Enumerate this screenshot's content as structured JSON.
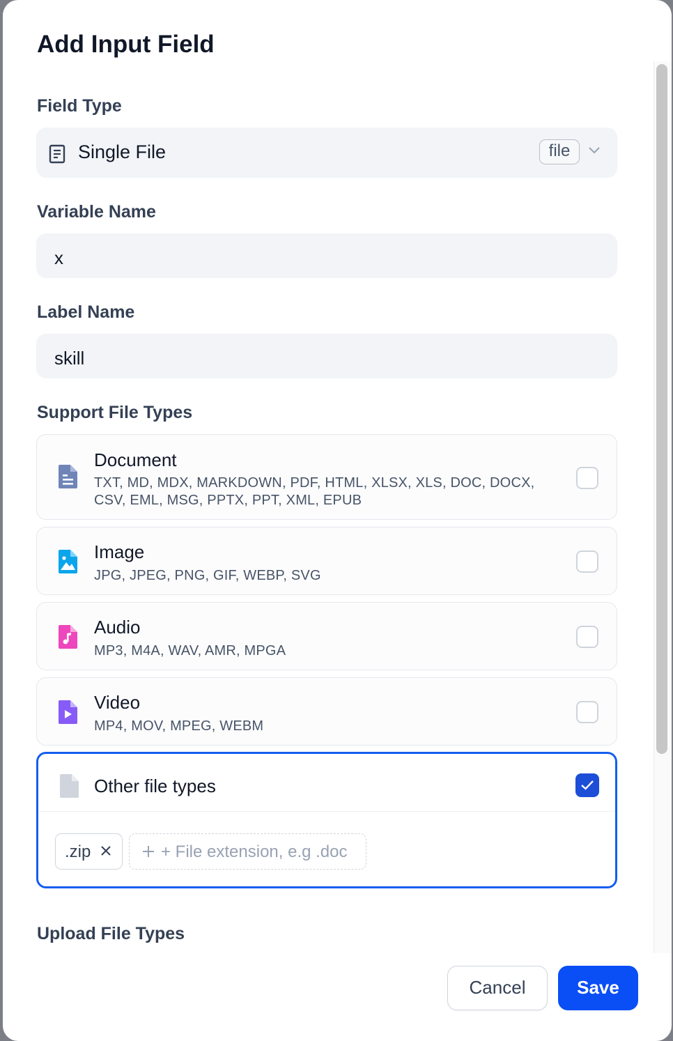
{
  "dialog": {
    "title": "Add Input Field"
  },
  "field_type": {
    "label": "Field Type",
    "value": "Single File",
    "badge": "file",
    "icon": "document-icon"
  },
  "variable_name": {
    "label": "Variable Name",
    "value": "x"
  },
  "label_name": {
    "label": "Label Name",
    "value": "skill"
  },
  "support_file_types": {
    "label": "Support File Types",
    "items": [
      {
        "name": "Document",
        "extensions": "TXT, MD, MDX, MARKDOWN, PDF, HTML, XLSX, XLS, DOC, DOCX, CSV, EML, MSG, PPTX, PPT, XML, EPUB",
        "checked": false,
        "icon": "document-file-icon",
        "color": "#6f85b8"
      },
      {
        "name": "Image",
        "extensions": "JPG, JPEG, PNG, GIF, WEBP, SVG",
        "checked": false,
        "icon": "image-file-icon",
        "color": "#0ba5ec"
      },
      {
        "name": "Audio",
        "extensions": "MP3, M4A, WAV, AMR, MPGA",
        "checked": false,
        "icon": "audio-file-icon",
        "color": "#ee46bc"
      },
      {
        "name": "Video",
        "extensions": "MP4, MOV, MPEG, WEBM",
        "checked": false,
        "icon": "video-file-icon",
        "color": "#875bf7"
      }
    ],
    "other": {
      "name": "Other file types",
      "checked": true,
      "icon": "other-file-icon",
      "tags": [
        ".zip"
      ],
      "placeholder": "+ File extension, e.g .doc"
    }
  },
  "upload_file_types": {
    "label": "Upload File Types"
  },
  "footer": {
    "cancel_label": "Cancel",
    "save_label": "Save"
  },
  "colors": {
    "accent": "#155eef",
    "save_button": "#0a4ef5"
  }
}
